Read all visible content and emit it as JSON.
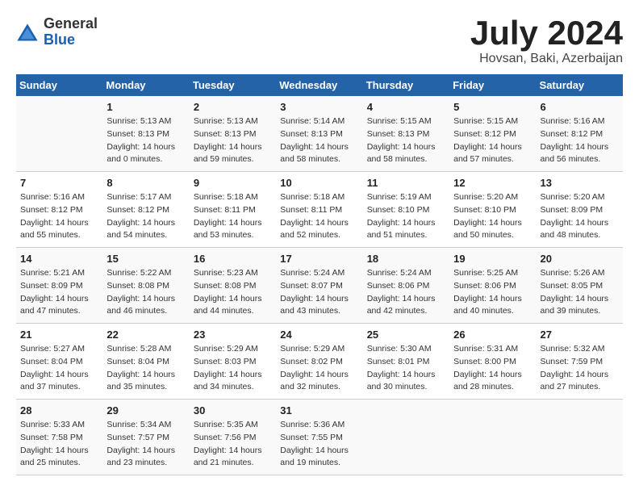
{
  "header": {
    "logo_general": "General",
    "logo_blue": "Blue",
    "month_title": "July 2024",
    "location": "Hovsan, Baki, Azerbaijan"
  },
  "days_of_week": [
    "Sunday",
    "Monday",
    "Tuesday",
    "Wednesday",
    "Thursday",
    "Friday",
    "Saturday"
  ],
  "weeks": [
    [
      {
        "day": "",
        "info": ""
      },
      {
        "day": "1",
        "sunrise": "5:13 AM",
        "sunset": "8:13 PM",
        "daylight": "14 hours and 0 minutes."
      },
      {
        "day": "2",
        "sunrise": "5:13 AM",
        "sunset": "8:13 PM",
        "daylight": "14 hours and 59 minutes."
      },
      {
        "day": "3",
        "sunrise": "5:14 AM",
        "sunset": "8:13 PM",
        "daylight": "14 hours and 58 minutes."
      },
      {
        "day": "4",
        "sunrise": "5:15 AM",
        "sunset": "8:13 PM",
        "daylight": "14 hours and 58 minutes."
      },
      {
        "day": "5",
        "sunrise": "5:15 AM",
        "sunset": "8:12 PM",
        "daylight": "14 hours and 57 minutes."
      },
      {
        "day": "6",
        "sunrise": "5:16 AM",
        "sunset": "8:12 PM",
        "daylight": "14 hours and 56 minutes."
      }
    ],
    [
      {
        "day": "7",
        "sunrise": "5:16 AM",
        "sunset": "8:12 PM",
        "daylight": "14 hours and 55 minutes."
      },
      {
        "day": "8",
        "sunrise": "5:17 AM",
        "sunset": "8:12 PM",
        "daylight": "14 hours and 54 minutes."
      },
      {
        "day": "9",
        "sunrise": "5:18 AM",
        "sunset": "8:11 PM",
        "daylight": "14 hours and 53 minutes."
      },
      {
        "day": "10",
        "sunrise": "5:18 AM",
        "sunset": "8:11 PM",
        "daylight": "14 hours and 52 minutes."
      },
      {
        "day": "11",
        "sunrise": "5:19 AM",
        "sunset": "8:10 PM",
        "daylight": "14 hours and 51 minutes."
      },
      {
        "day": "12",
        "sunrise": "5:20 AM",
        "sunset": "8:10 PM",
        "daylight": "14 hours and 50 minutes."
      },
      {
        "day": "13",
        "sunrise": "5:20 AM",
        "sunset": "8:09 PM",
        "daylight": "14 hours and 48 minutes."
      }
    ],
    [
      {
        "day": "14",
        "sunrise": "5:21 AM",
        "sunset": "8:09 PM",
        "daylight": "14 hours and 47 minutes."
      },
      {
        "day": "15",
        "sunrise": "5:22 AM",
        "sunset": "8:08 PM",
        "daylight": "14 hours and 46 minutes."
      },
      {
        "day": "16",
        "sunrise": "5:23 AM",
        "sunset": "8:08 PM",
        "daylight": "14 hours and 44 minutes."
      },
      {
        "day": "17",
        "sunrise": "5:24 AM",
        "sunset": "8:07 PM",
        "daylight": "14 hours and 43 minutes."
      },
      {
        "day": "18",
        "sunrise": "5:24 AM",
        "sunset": "8:06 PM",
        "daylight": "14 hours and 42 minutes."
      },
      {
        "day": "19",
        "sunrise": "5:25 AM",
        "sunset": "8:06 PM",
        "daylight": "14 hours and 40 minutes."
      },
      {
        "day": "20",
        "sunrise": "5:26 AM",
        "sunset": "8:05 PM",
        "daylight": "14 hours and 39 minutes."
      }
    ],
    [
      {
        "day": "21",
        "sunrise": "5:27 AM",
        "sunset": "8:04 PM",
        "daylight": "14 hours and 37 minutes."
      },
      {
        "day": "22",
        "sunrise": "5:28 AM",
        "sunset": "8:04 PM",
        "daylight": "14 hours and 35 minutes."
      },
      {
        "day": "23",
        "sunrise": "5:29 AM",
        "sunset": "8:03 PM",
        "daylight": "14 hours and 34 minutes."
      },
      {
        "day": "24",
        "sunrise": "5:29 AM",
        "sunset": "8:02 PM",
        "daylight": "14 hours and 32 minutes."
      },
      {
        "day": "25",
        "sunrise": "5:30 AM",
        "sunset": "8:01 PM",
        "daylight": "14 hours and 30 minutes."
      },
      {
        "day": "26",
        "sunrise": "5:31 AM",
        "sunset": "8:00 PM",
        "daylight": "14 hours and 28 minutes."
      },
      {
        "day": "27",
        "sunrise": "5:32 AM",
        "sunset": "7:59 PM",
        "daylight": "14 hours and 27 minutes."
      }
    ],
    [
      {
        "day": "28",
        "sunrise": "5:33 AM",
        "sunset": "7:58 PM",
        "daylight": "14 hours and 25 minutes."
      },
      {
        "day": "29",
        "sunrise": "5:34 AM",
        "sunset": "7:57 PM",
        "daylight": "14 hours and 23 minutes."
      },
      {
        "day": "30",
        "sunrise": "5:35 AM",
        "sunset": "7:56 PM",
        "daylight": "14 hours and 21 minutes."
      },
      {
        "day": "31",
        "sunrise": "5:36 AM",
        "sunset": "7:55 PM",
        "daylight": "14 hours and 19 minutes."
      },
      {
        "day": "",
        "info": ""
      },
      {
        "day": "",
        "info": ""
      },
      {
        "day": "",
        "info": ""
      }
    ]
  ]
}
